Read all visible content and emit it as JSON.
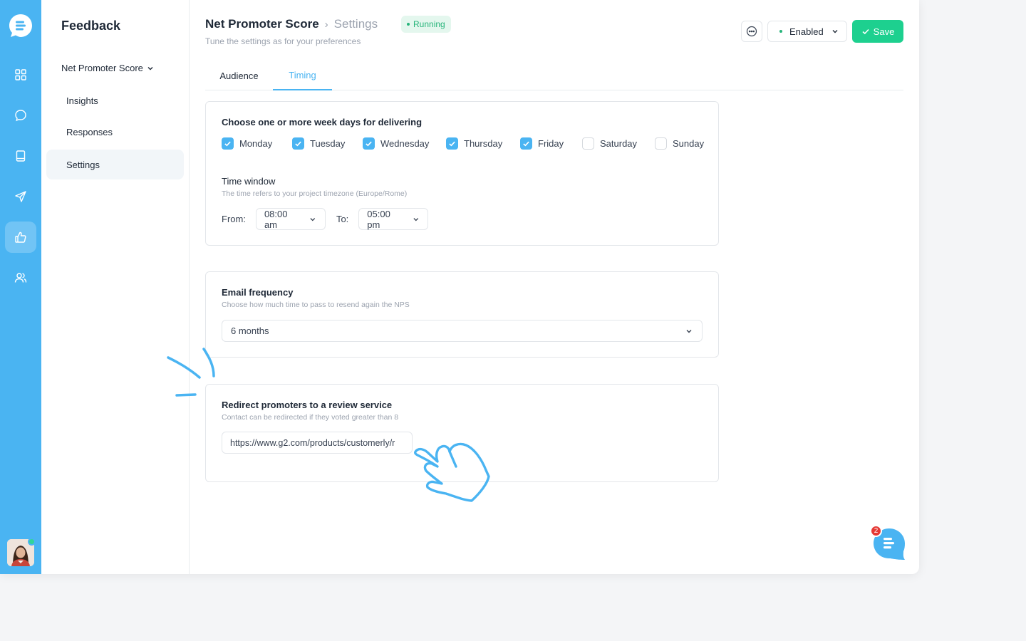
{
  "app": {
    "title": "Feedback",
    "section": "Net Promoter Score",
    "nav": [
      {
        "label": "Insights"
      },
      {
        "label": "Responses"
      },
      {
        "label": "Settings"
      }
    ]
  },
  "rail": {
    "icons": [
      "dashboard-icon",
      "chat-icon",
      "book-icon",
      "send-icon",
      "thumbs-up-icon",
      "users-icon"
    ],
    "active": "thumbs-up-icon"
  },
  "header": {
    "breadcrumb_main": "Net Promoter Score",
    "breadcrumb_sep": "›",
    "breadcrumb_sub": "Settings",
    "status": "Running",
    "subtitle": "Tune the settings as for your preferences",
    "enabled_label": "Enabled",
    "save_label": "Save"
  },
  "tabs": [
    {
      "label": "Audience",
      "active": false
    },
    {
      "label": "Timing",
      "active": true
    }
  ],
  "delivery": {
    "title": "Choose one or more week days for delivering",
    "days": [
      {
        "label": "Monday",
        "checked": true
      },
      {
        "label": "Tuesday",
        "checked": true
      },
      {
        "label": "Wednesday",
        "checked": true
      },
      {
        "label": "Thursday",
        "checked": true
      },
      {
        "label": "Friday",
        "checked": true
      },
      {
        "label": "Saturday",
        "checked": false
      },
      {
        "label": "Sunday",
        "checked": false
      }
    ],
    "time_window_title": "Time window",
    "time_window_hint": "The time refers to your project timezone (Europe/Rome)",
    "from_label": "From:",
    "from_value": "08:00 am",
    "to_label": "To:",
    "to_value": "05:00 pm"
  },
  "email_frequency": {
    "title": "Email frequency",
    "hint": "Choose how much time to pass to resend again the NPS",
    "value": "6 months"
  },
  "redirect": {
    "title": "Redirect promoters to a review service",
    "hint": "Contact can be redirected if they voted greater than 8",
    "url": "https://www.g2.com/products/customerly/r"
  },
  "chat": {
    "badge": "2"
  },
  "colors": {
    "accent": "#4ab4f2",
    "success": "#1dd08f",
    "badge": "#e53935"
  }
}
